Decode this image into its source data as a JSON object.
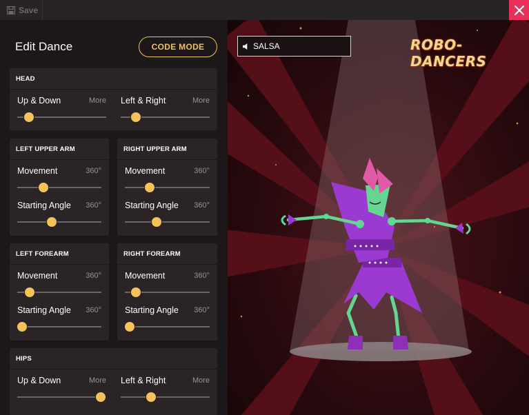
{
  "toolbar": {
    "save_label": "Save",
    "close_icon": "close-icon"
  },
  "editor": {
    "title": "Edit Dance",
    "code_mode_label": "CODE MODE",
    "slider_color": "#f6c25c",
    "sections": {
      "head": {
        "title": "HEAD",
        "controls": [
          {
            "label": "Up & Down",
            "meta": "More",
            "value": 0.13
          },
          {
            "label": "Left & Right",
            "meta": "More",
            "value": 0.17
          }
        ]
      },
      "left_upper_arm": {
        "title": "LEFT UPPER ARM",
        "controls": [
          {
            "label": "Movement",
            "meta": "360°",
            "value": 0.31
          },
          {
            "label": "Starting Angle",
            "meta": "360°",
            "value": 0.41
          }
        ]
      },
      "right_upper_arm": {
        "title": "RIGHT UPPER ARM",
        "controls": [
          {
            "label": "Movement",
            "meta": "360°",
            "value": 0.29
          },
          {
            "label": "Starting Angle",
            "meta": "360°",
            "value": 0.37
          }
        ]
      },
      "left_forearm": {
        "title": "LEFT FOREARM",
        "controls": [
          {
            "label": "Movement",
            "meta": "360°",
            "value": 0.15
          },
          {
            "label": "Starting Angle",
            "meta": "360°",
            "value": 0.06
          }
        ]
      },
      "right_forearm": {
        "title": "RIGHT FOREARM",
        "controls": [
          {
            "label": "Movement",
            "meta": "360°",
            "value": 0.13
          },
          {
            "label": "Starting Angle",
            "meta": "360°",
            "value": 0.06
          }
        ]
      },
      "hips": {
        "title": "HIPS",
        "controls": [
          {
            "label": "Up & Down",
            "meta": "More",
            "value": 0.94
          },
          {
            "label": "Left & Right",
            "meta": "More",
            "value": 0.34
          }
        ]
      }
    }
  },
  "stage": {
    "song": "SALSA",
    "speaker_icon": "speaker-icon",
    "logo_text": "ROBO-DANCERS"
  }
}
